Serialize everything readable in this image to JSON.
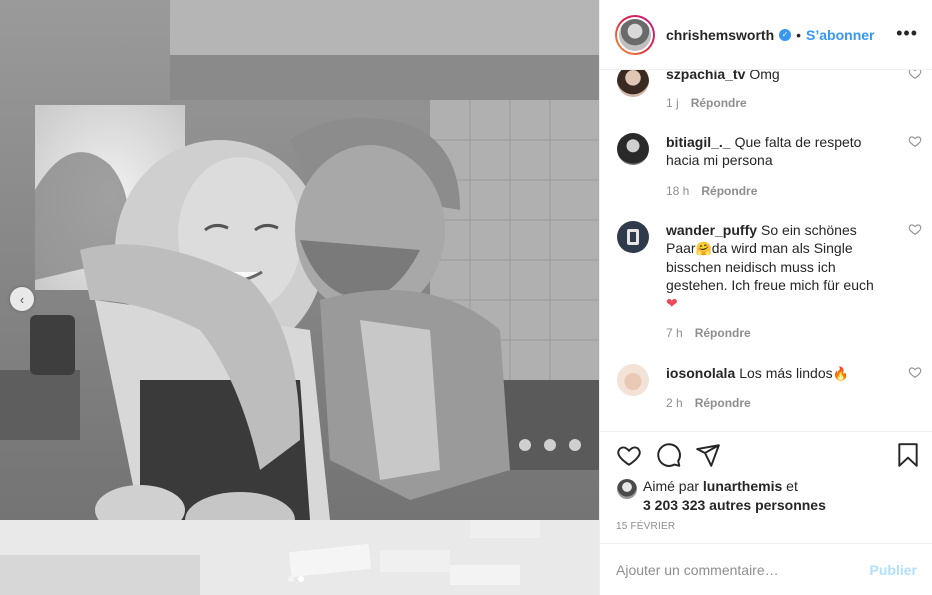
{
  "post": {
    "photo_alt": "",
    "carousel": {
      "current": 2,
      "total": 2
    },
    "nav_prev_glyph": "‹"
  },
  "header": {
    "username": "chrishemsworth",
    "verified_glyph": "✓",
    "separator": "•",
    "follow_label": "S’abonner",
    "more_glyph": "•••"
  },
  "comments": [
    {
      "user": "szpachia_tv",
      "text": "Omg",
      "time": "1 j",
      "reply": "Répondre"
    },
    {
      "user": "bitiagil_._",
      "text": "Que falta de respeto hacia mi persona",
      "time": "18 h",
      "reply": "Répondre"
    },
    {
      "user": "wander_puffy",
      "text_before": "So ein schönes Paar",
      "emoji_1": "🤗",
      "text_after": "da wird man als Single bisschen neidisch muss ich gestehen. Ich freue mich für euch",
      "emoji_2": "❤",
      "time": "7 h",
      "reply": "Répondre"
    },
    {
      "user": "iosonolala",
      "text": "Los más lindos",
      "emoji": "🔥",
      "time": "2 h",
      "reply": "Répondre"
    }
  ],
  "actions": {
    "like_icon": "heart-icon",
    "comment_icon": "comment-icon",
    "share_icon": "share-icon",
    "save_icon": "bookmark-icon"
  },
  "likes": {
    "prefix": "Aimé par",
    "user": "lunarthemis",
    "connector": "et",
    "count": "3 203 323 autres personnes"
  },
  "date": "15 FÉVRIER",
  "add_comment": {
    "placeholder": "Ajouter un commentaire…",
    "publish_label": "Publier"
  },
  "colors": {
    "accent": "#3897f0",
    "text": "#262626",
    "muted": "#8e8e8e",
    "publish_disabled": "#b2dffc",
    "border": "#efefef"
  }
}
